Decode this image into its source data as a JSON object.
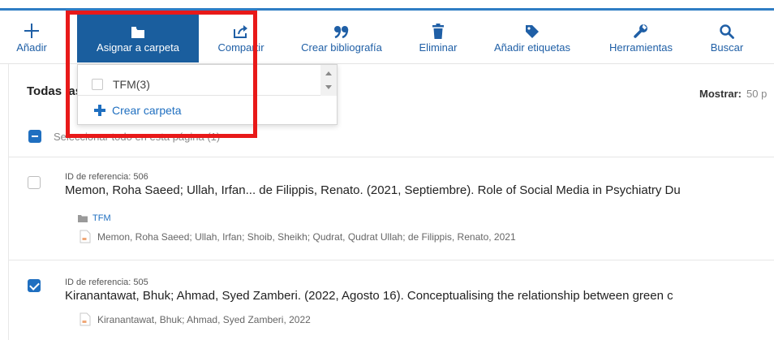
{
  "toolbar": {
    "items": [
      {
        "label": "Añadir",
        "icon": "plus-icon"
      },
      {
        "label": "Asignar a carpeta",
        "icon": "folder-icon"
      },
      {
        "label": "Compartir",
        "icon": "share-icon"
      },
      {
        "label": "Crear bibliografía",
        "icon": "quote-icon"
      },
      {
        "label": "Eliminar",
        "icon": "trash-icon"
      },
      {
        "label": "Añadir etiquetas",
        "icon": "tag-icon"
      },
      {
        "label": "Herramientas",
        "icon": "wrench-icon"
      },
      {
        "label": "Buscar",
        "icon": "search-icon"
      }
    ],
    "active_index": 1,
    "accent_color": "#1a5e9e"
  },
  "page": {
    "title": "Todas las",
    "show_label": "Mostrar:",
    "show_value": "50 p"
  },
  "select_all": {
    "label": "Seleccionar todo en esta página (1)"
  },
  "folder_dropdown": {
    "folder_label": "TFM(3)",
    "create_label": "Crear carpeta"
  },
  "references": [
    {
      "ref_id": "ID de referencia: 506",
      "citation": "Memon, Roha Saeed; Ullah, Irfan... de Filippis, Renato. (2021, Septiembre). Role of Social Media in Psychiatry Du",
      "folder": "TFM",
      "authors": "Memon, Roha Saeed; Ullah, Irfan; Shoib, Sheikh; Qudrat, Qudrat Ullah; de Filippis, Renato, 2021",
      "checked": false
    },
    {
      "ref_id": "ID de referencia: 505",
      "citation": "Kiranantawat, Bhuk; Ahmad, Syed Zamberi. (2022, Agosto 16). Conceptualising the relationship between green c",
      "folder": "",
      "authors": "Kiranantawat, Bhuk; Ahmad, Syed Zamberi, 2022",
      "checked": true
    }
  ]
}
